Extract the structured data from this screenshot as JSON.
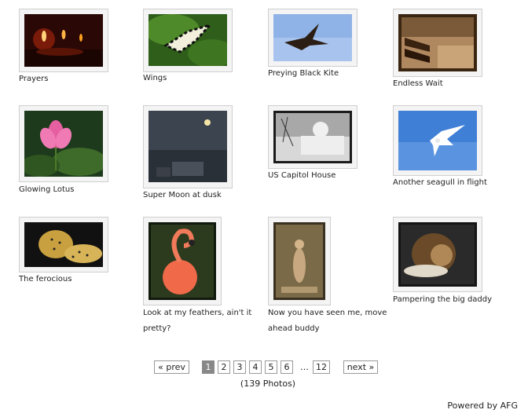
{
  "photos": [
    {
      "title": "Prayers"
    },
    {
      "title": "Wings"
    },
    {
      "title": "Preying Black Kite"
    },
    {
      "title": "Endless Wait"
    },
    {
      "title": "Glowing Lotus"
    },
    {
      "title": "Super Moon at dusk"
    },
    {
      "title": "US Capitol House"
    },
    {
      "title": "Another seagull in flight"
    },
    {
      "title": "The ferocious"
    },
    {
      "title": "Look at my feathers, ain't it pretty?"
    },
    {
      "title": "Now you have seen me, move ahead buddy"
    },
    {
      "title": "Pampering the big daddy"
    }
  ],
  "pagination": {
    "prev": "« prev",
    "pages": [
      "1",
      "2",
      "3",
      "4",
      "5",
      "6"
    ],
    "ellipsis": "…",
    "last": "12",
    "next": "next »",
    "current_page": "1"
  },
  "photo_count": "(139 Photos)",
  "powered_by": "Powered by AFG"
}
